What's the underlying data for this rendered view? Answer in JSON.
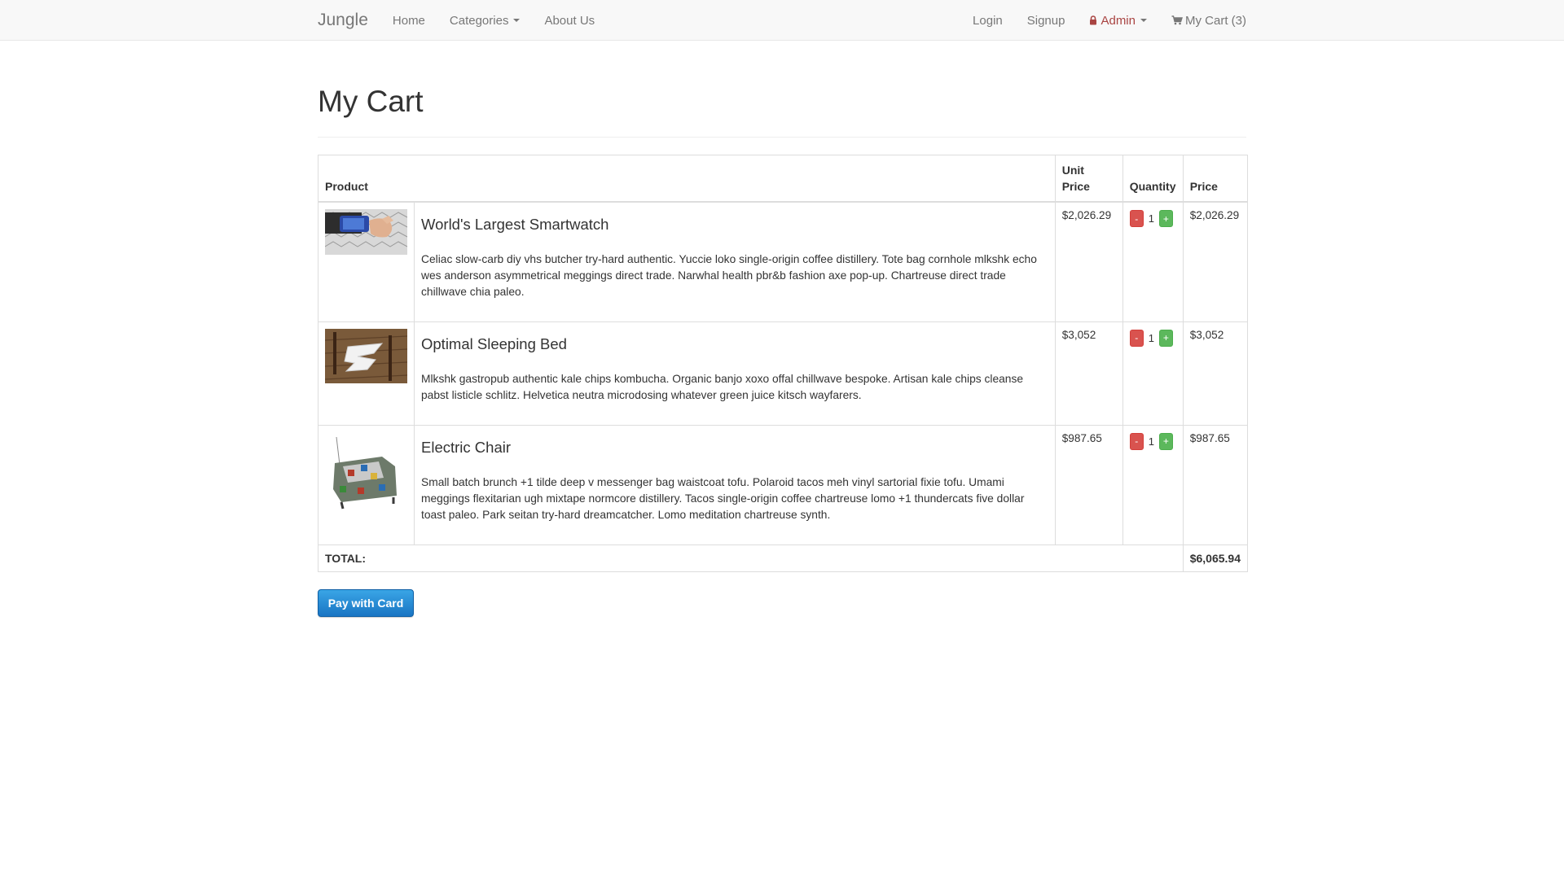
{
  "nav": {
    "brand": "Jungle",
    "left": [
      "Home",
      "Categories",
      "About Us"
    ],
    "login": "Login",
    "signup": "Signup",
    "admin": "Admin",
    "cart": "My Cart (3)",
    "admin_color": "#a94442"
  },
  "page": {
    "title": "My Cart"
  },
  "table": {
    "headers": {
      "product": "Product",
      "unit_price_1": "Unit",
      "unit_price_2": "Price",
      "quantity": "Quantity",
      "price": "Price"
    },
    "rows": [
      {
        "name": "World's Largest Smartwatch",
        "description": "Celiac slow-carb diy vhs butcher try-hard authentic. Yuccie loko single-origin coffee distillery. Tote bag cornhole mlkshk echo wes anderson asymmetrical meggings direct trade. Narwhal health pbr&b fashion axe pop-up. Chartreuse direct trade chillwave chia paleo.",
        "unit_price": "$2,026.29",
        "quantity": "1",
        "price": "$2,026.29"
      },
      {
        "name": "Optimal Sleeping Bed",
        "description": "Mlkshk gastropub authentic kale chips kombucha. Organic banjo xoxo offal chillwave bespoke. Artisan kale chips cleanse pabst listicle schlitz. Helvetica neutra microdosing whatever green juice kitsch wayfarers.",
        "unit_price": "$3,052",
        "quantity": "1",
        "price": "$3,052"
      },
      {
        "name": "Electric Chair",
        "description": "Small batch brunch +1 tilde deep v messenger bag waistcoat tofu. Polaroid tacos meh vinyl sartorial fixie tofu. Umami meggings flexitarian ugh mixtape normcore distillery. Tacos single-origin coffee chartreuse lomo +1 thundercats five dollar toast paleo. Park seitan try-hard dreamcatcher. Lomo meditation chartreuse synth.",
        "unit_price": "$987.65",
        "quantity": "1",
        "price": "$987.65"
      }
    ],
    "qty_minus": "-",
    "qty_plus": "+",
    "total_label": "TOTAL:",
    "total_value": "$6,065.94"
  },
  "pay_button": "Pay with Card",
  "icons": {
    "admin": "lock-icon",
    "cart": "shopping-cart-icon"
  }
}
